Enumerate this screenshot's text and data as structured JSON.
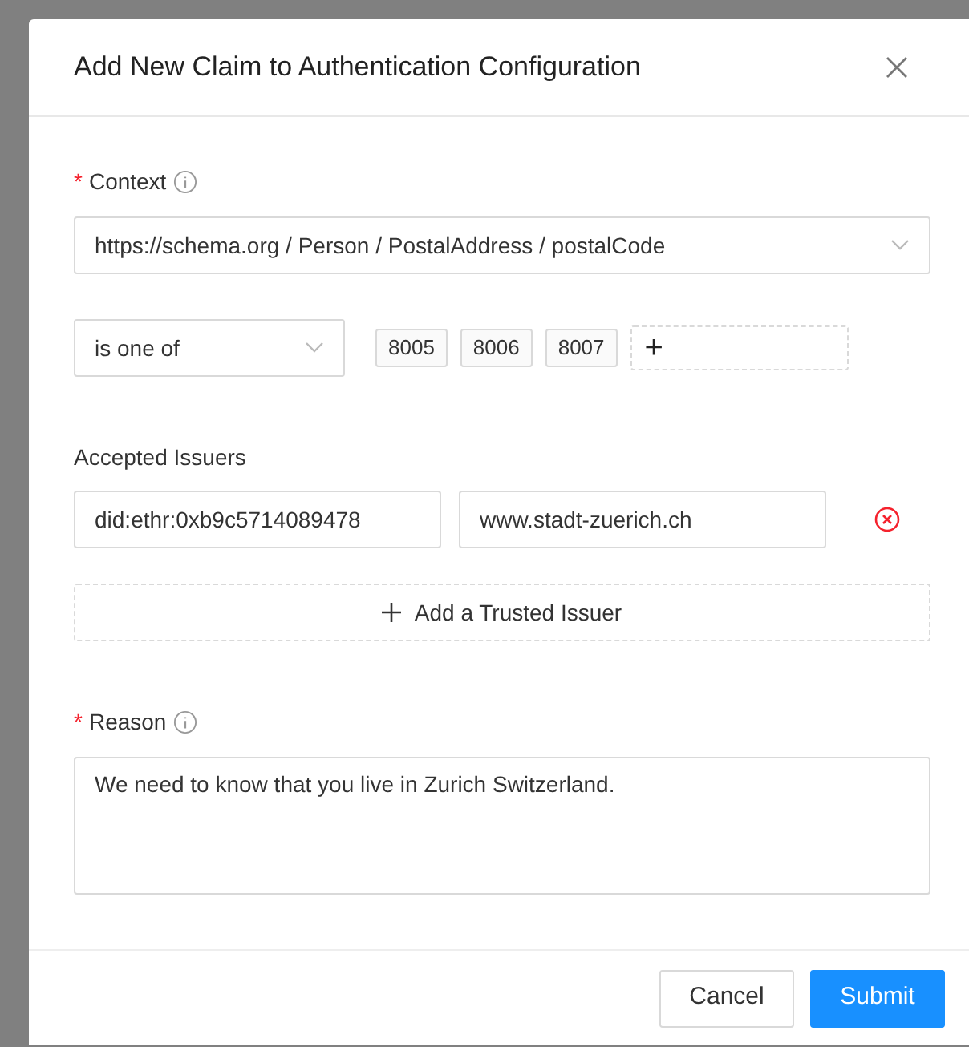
{
  "dialog": {
    "title": "Add New Claim to Authentication Configuration"
  },
  "context": {
    "label": "Context",
    "required": true,
    "required_mark": "*",
    "value": "https://schema.org / Person / PostalAddress / postalCode"
  },
  "condition": {
    "operator": "is one of",
    "tags": [
      "8005",
      "8006",
      "8007"
    ],
    "add_symbol": "+"
  },
  "accepted_issuers": {
    "label": "Accepted Issuers",
    "issuers": [
      {
        "did": "did:ethr:0xb9c5714089478",
        "domain": "www.stadt-zuerich.ch"
      }
    ],
    "add_button": "Add a Trusted Issuer"
  },
  "reason": {
    "label": "Reason",
    "required": true,
    "required_mark": "*",
    "value": "We need to know that you live in Zurich Switzerland."
  },
  "buttons": [
    {
      "label": "Cancel",
      "kind": "default"
    },
    {
      "label": "Submit",
      "kind": "primary"
    }
  ]
}
